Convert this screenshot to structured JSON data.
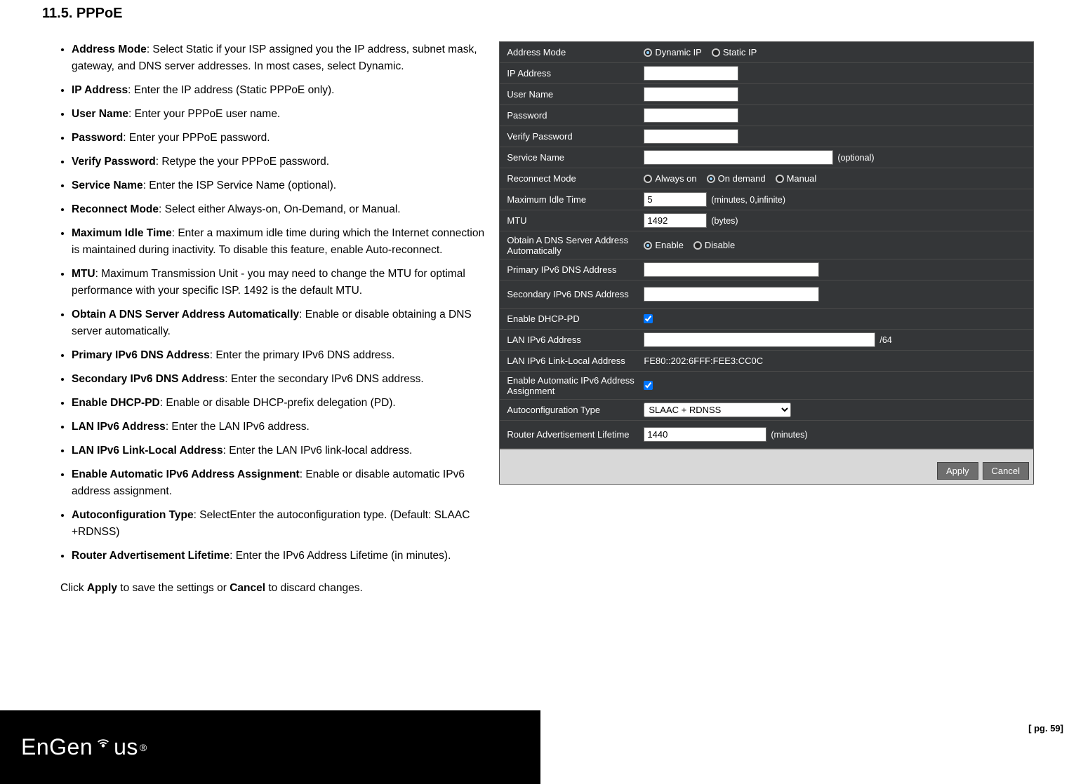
{
  "heading": "11.5.  PPPoE",
  "bullets": [
    {
      "term": "Address Mode",
      "desc": ": Select Static if your ISP assigned you the IP address, subnet mask, gateway, and DNS server addresses. In most cases, select Dynamic."
    },
    {
      "term": "IP Address",
      "desc": ": Enter the IP address (Static PPPoE only)."
    },
    {
      "term": "User Name",
      "desc": ": Enter your PPPoE user name."
    },
    {
      "term": "Password",
      "desc": ": Enter your PPPoE password."
    },
    {
      "term": "Verify Password",
      "desc": ": Retype the your PPPoE password."
    },
    {
      "term": "Service Name",
      "desc": ": Enter the ISP Service Name (optional)."
    },
    {
      "term": "Reconnect Mode",
      "desc": ": Select either Always-on, On-Demand, or Manual."
    },
    {
      "term": "Maximum Idle Time",
      "desc": ": Enter a maximum idle time during which the Internet connection is maintained during inactivity. To disable this feature, enable Auto-reconnect."
    },
    {
      "term": "MTU",
      "desc": ": Maximum Transmission Unit - you may need to change the MTU for optimal performance with your specific ISP. 1492 is the default MTU."
    },
    {
      "term": "Obtain A DNS Server Address Automatically",
      "desc": ": Enable or disable obtaining a DNS server automatically."
    },
    {
      "term": "Primary IPv6 DNS Address",
      "desc": ": Enter the primary IPv6 DNS address."
    },
    {
      "term": "Secondary IPv6 DNS Address",
      "desc": ": Enter the secondary IPv6 DNS address."
    },
    {
      "term": "Enable DHCP-PD",
      "desc": ": Enable or disable DHCP-prefix delegation (PD)."
    },
    {
      "term": "LAN IPv6 Address",
      "desc": ": Enter the LAN IPv6 address."
    },
    {
      "term": "LAN IPv6 Link-Local Address",
      "desc": ": Enter the LAN IPv6 link-local address."
    },
    {
      "term": "Enable Automatic IPv6 Address Assignment",
      "desc": ": Enable or disable automatic IPv6 address assignment."
    },
    {
      "term": "Autoconfiguration Type",
      "desc": ": SelectEnter the autoconfiguration type. (Default: SLAAC +RDNSS)"
    },
    {
      "term": "Router Advertisement Lifetime",
      "desc": ": Enter the IPv6 Address Lifetime (in minutes)."
    }
  ],
  "footer_note_pre": "Click ",
  "footer_note_apply": "Apply",
  "footer_note_mid": " to save the settings or ",
  "footer_note_cancel": "Cancel",
  "footer_note_post": " to discard changes.",
  "panel": {
    "address_mode": {
      "label": "Address Mode",
      "opt1": "Dynamic IP",
      "opt2": "Static IP"
    },
    "ip_address": {
      "label": "IP Address",
      "value": ""
    },
    "user_name": {
      "label": "User Name",
      "value": ""
    },
    "password": {
      "label": "Password",
      "value": ""
    },
    "verify_password": {
      "label": "Verify Password",
      "value": ""
    },
    "service_name": {
      "label": "Service Name",
      "value": "",
      "hint": "(optional)"
    },
    "reconnect_mode": {
      "label": "Reconnect Mode",
      "opt1": "Always on",
      "opt2": "On demand",
      "opt3": "Manual"
    },
    "max_idle": {
      "label": "Maximum Idle Time",
      "value": "5",
      "hint": "(minutes, 0,infinite)"
    },
    "mtu": {
      "label": "MTU",
      "value": "1492",
      "hint": "(bytes)"
    },
    "obtain_dns": {
      "label": "Obtain A DNS Server Address Automatically",
      "opt1": "Enable",
      "opt2": "Disable"
    },
    "primary_dns": {
      "label": "Primary IPv6 DNS Address",
      "value": ""
    },
    "secondary_dns": {
      "label": "Secondary IPv6 DNS Address",
      "value": ""
    },
    "dhcp_pd": {
      "label": "Enable DHCP-PD"
    },
    "lan_ipv6": {
      "label": "LAN IPv6 Address",
      "value": "",
      "suffix": "/64"
    },
    "lan_ipv6_ll": {
      "label": "LAN IPv6 Link-Local Address",
      "value": "FE80::202:6FFF:FEE3:CC0C"
    },
    "auto_assign": {
      "label": "Enable Automatic IPv6 Address Assignment"
    },
    "autoconfig": {
      "label": "Autoconfiguration Type",
      "value": "SLAAC + RDNSS"
    },
    "ra_lifetime": {
      "label": "Router Advertisement Lifetime",
      "value": "1440",
      "hint": "(minutes)"
    },
    "btn_apply": "Apply",
    "btn_cancel": "Cancel"
  },
  "logo": {
    "pre": "EnGen",
    "post": "us",
    "reg": "®"
  },
  "page_num": "[ pg. 59]"
}
